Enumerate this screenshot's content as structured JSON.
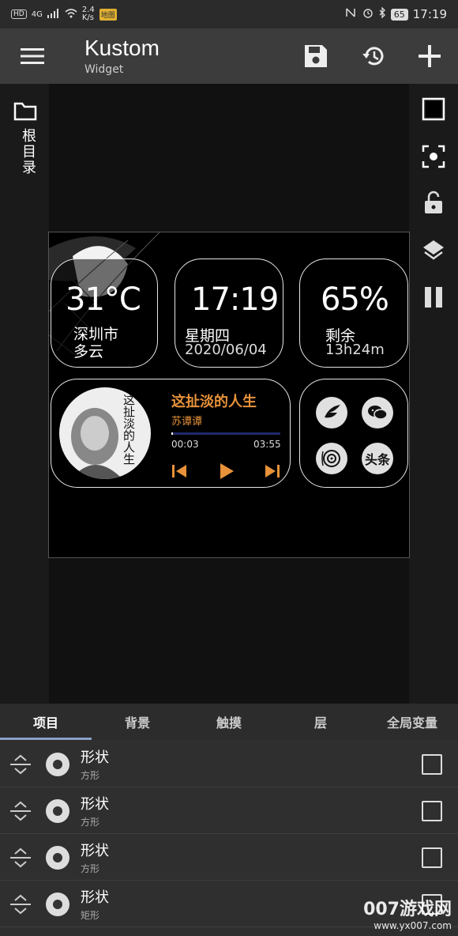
{
  "status_bar": {
    "left_badge": "HD",
    "network": "4G",
    "speed_value": "2.4",
    "speed_unit": "K/s",
    "app_badge": "地图",
    "battery": "65",
    "time": "17:19"
  },
  "app_bar": {
    "title": "Kustom",
    "subtitle": "Widget"
  },
  "left_rail": {
    "folder_label": "根目录"
  },
  "widget": {
    "weather": {
      "temp": "31°C",
      "city": "深圳市",
      "condition": "多云"
    },
    "clock": {
      "time": "17:19",
      "weekday": "星期四",
      "date": "2020/06/04"
    },
    "battery": {
      "percent": "65%",
      "label": "剩余",
      "remaining": "13h24m"
    },
    "music": {
      "album_text": "这扯淡的人生",
      "title": "这扯淡的人生",
      "artist": "苏谭谭",
      "current": "00:03",
      "total": "03:55",
      "progress": 0.013
    },
    "apps": [
      {
        "icon": "feather-app-icon",
        "label": ""
      },
      {
        "icon": "wechat-icon",
        "label": ""
      },
      {
        "icon": "music-disc-icon",
        "label": ""
      },
      {
        "icon": "toutiao-icon",
        "label": "头条"
      }
    ]
  },
  "tabs": [
    {
      "label": "项目",
      "active": true
    },
    {
      "label": "背景",
      "active": false
    },
    {
      "label": "触摸",
      "active": false
    },
    {
      "label": "层",
      "active": false
    },
    {
      "label": "全局变量",
      "active": false
    }
  ],
  "items": [
    {
      "title": "形状",
      "subtitle": "方形"
    },
    {
      "title": "形状",
      "subtitle": "方形"
    },
    {
      "title": "形状",
      "subtitle": "方形"
    },
    {
      "title": "形状",
      "subtitle": "矩形"
    }
  ],
  "watermark": {
    "line1": "007游戏网",
    "line2": "www.yx007.com"
  },
  "colors": {
    "accent_orange": "#e8923a",
    "tab_indicator": "#8aa0c8",
    "app_bar": "#3c3c3c"
  }
}
